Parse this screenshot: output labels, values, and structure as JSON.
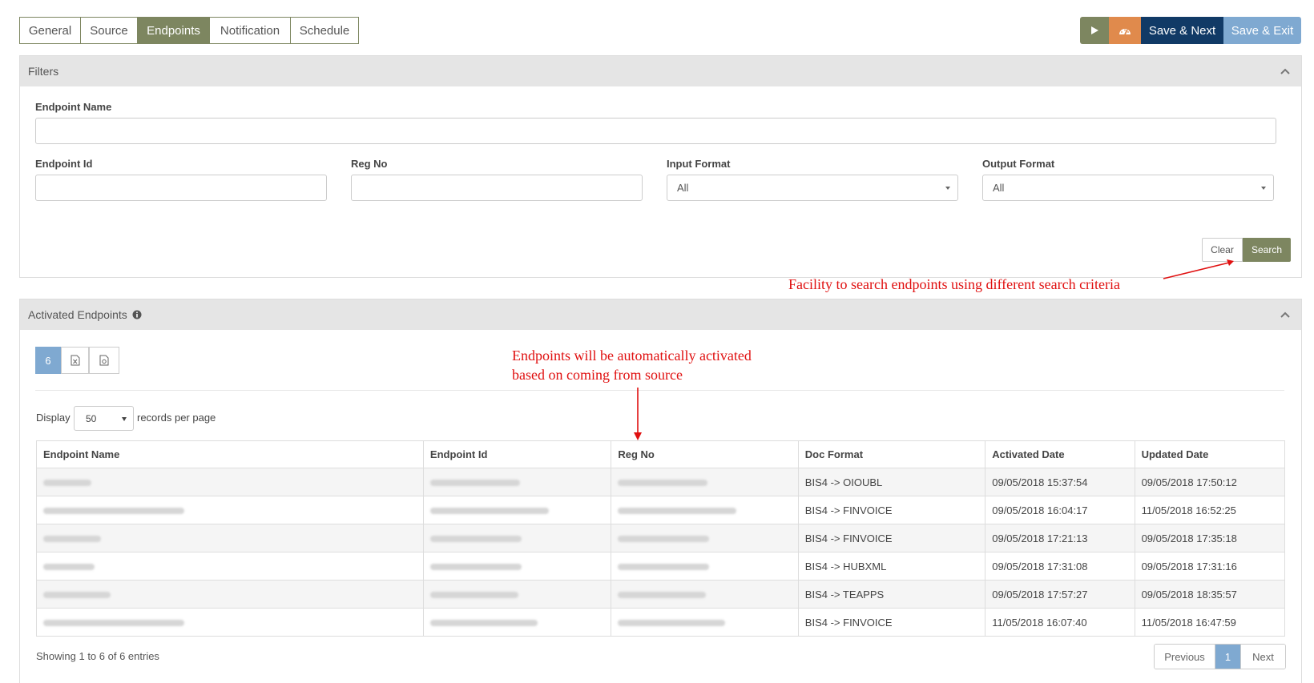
{
  "tabs": [
    {
      "label": "General",
      "active": false
    },
    {
      "label": "Source",
      "active": false
    },
    {
      "label": "Endpoints",
      "active": true
    },
    {
      "label": "Notification",
      "active": false
    },
    {
      "label": "Schedule",
      "active": false
    }
  ],
  "toolbar": {
    "run_icon": "play-icon",
    "dashboard_icon": "gauge-icon",
    "save_next_label": "Save & Next",
    "save_exit_label": "Save & Exit"
  },
  "filters": {
    "title": "Filters",
    "endpoint_name_label": "Endpoint Name",
    "endpoint_name_value": "",
    "endpoint_id_label": "Endpoint Id",
    "endpoint_id_value": "",
    "reg_no_label": "Reg No",
    "reg_no_value": "",
    "input_format_label": "Input Format",
    "input_format_value": "All",
    "output_format_label": "Output Format",
    "output_format_value": "All",
    "clear_label": "Clear",
    "search_label": "Search"
  },
  "annotations": {
    "search_note": "Facility to search endpoints using different search criteria",
    "activation_note_line1": "Endpoints will be automatically activated",
    "activation_note_line2": "based on coming from source"
  },
  "activated": {
    "title": "Activated Endpoints",
    "count_label": "6",
    "display_label": "Display",
    "page_size": "50",
    "records_label": "records per page",
    "columns": [
      "Endpoint Name",
      "Endpoint Id",
      "Reg No",
      "Doc Format",
      "Activated Date",
      "Updated Date"
    ],
    "rows": [
      {
        "doc_format": "BIS4 -> OIOUBL",
        "activated": "09/05/2018 15:37:54",
        "updated": "09/05/2018 17:50:12"
      },
      {
        "doc_format": "BIS4 -> FINVOICE",
        "activated": "09/05/2018 16:04:17",
        "updated": "11/05/2018 16:52:25"
      },
      {
        "doc_format": "BIS4 -> FINVOICE",
        "activated": "09/05/2018 17:21:13",
        "updated": "09/05/2018 17:35:18"
      },
      {
        "doc_format": "BIS4 -> HUBXML",
        "activated": "09/05/2018 17:31:08",
        "updated": "09/05/2018 17:31:16"
      },
      {
        "doc_format": "BIS4 -> TEAPPS",
        "activated": "09/05/2018 17:57:27",
        "updated": "09/05/2018 18:35:57"
      },
      {
        "doc_format": "BIS4 -> FINVOICE",
        "activated": "11/05/2018 16:07:40",
        "updated": "11/05/2018 16:47:59"
      }
    ],
    "showing": "Showing 1 to 6 of 6 entries",
    "prev_label": "Previous",
    "current_page": "1",
    "next_label": "Next"
  },
  "colors": {
    "olive": "#7d8660",
    "navy": "#113a66",
    "light_blue": "#7fa9d1",
    "orange": "#e08a4c",
    "annotation_red": "#e01010"
  }
}
